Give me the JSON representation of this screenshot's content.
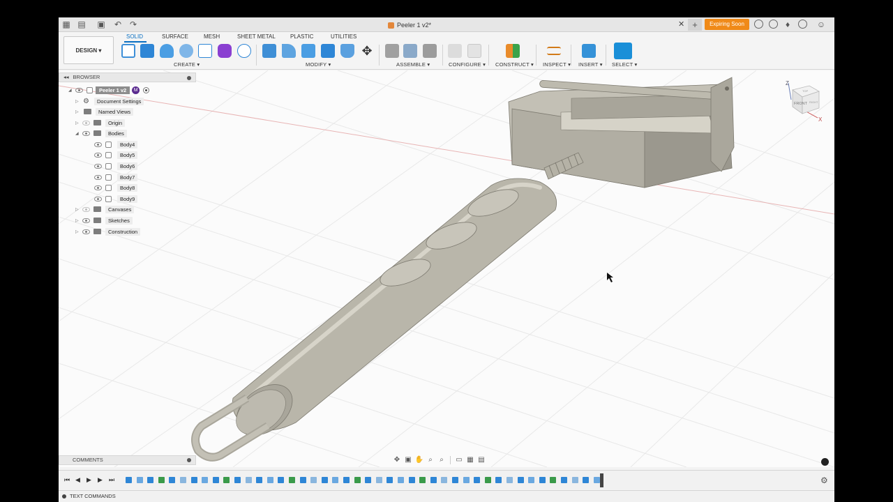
{
  "window": {
    "doc_title": "Peeler 1 v2*",
    "expiring_label": "Expiring Soon"
  },
  "toolbar": {
    "workspace_button": "DESIGN",
    "tabs": [
      "SOLID",
      "SURFACE",
      "MESH",
      "SHEET METAL",
      "PLASTIC",
      "UTILITIES"
    ],
    "groups": [
      "CREATE",
      "MODIFY",
      "ASSEMBLE",
      "CONFIGURE",
      "CONSTRUCT",
      "INSPECT",
      "INSERT",
      "SELECT"
    ]
  },
  "browser": {
    "title": "BROWSER",
    "root": "Peeler 1 v2",
    "items": [
      {
        "label": "Document Settings",
        "type": "settings"
      },
      {
        "label": "Named Views",
        "type": "folder"
      },
      {
        "label": "Origin",
        "type": "folder"
      },
      {
        "label": "Bodies",
        "type": "folder"
      },
      {
        "label": "Body4",
        "type": "body"
      },
      {
        "label": "Body5",
        "type": "body"
      },
      {
        "label": "Body6",
        "type": "body"
      },
      {
        "label": "Body7",
        "type": "body"
      },
      {
        "label": "Body8",
        "type": "body"
      },
      {
        "label": "Body9",
        "type": "body"
      },
      {
        "label": "Canvases",
        "type": "folder"
      },
      {
        "label": "Sketches",
        "type": "folder"
      },
      {
        "label": "Construction",
        "type": "folder"
      }
    ]
  },
  "viewcube": {
    "z": "Z",
    "x": "X",
    "front": "FRONT",
    "top": "TOP",
    "right": "RIGHT"
  },
  "comments_label": "COMMENTS",
  "text_commands_label": "TEXT COMMANDS",
  "colors": {
    "accent": "#0a6fc2",
    "expiring": "#f08a18",
    "model": "#b5b2a6"
  }
}
